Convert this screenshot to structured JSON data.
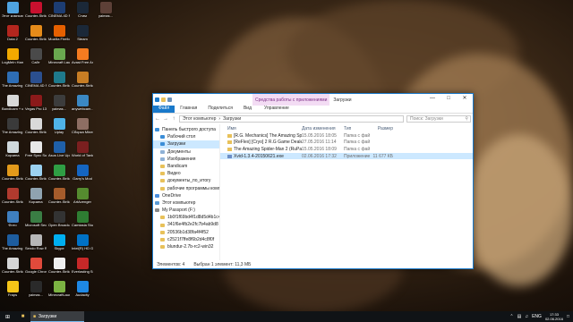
{
  "desktop": {
    "icons": [
      {
        "label": "Этот компьютер",
        "color": "#4fa3e0"
      },
      {
        "label": "Dota 2",
        "color": "#b3261e"
      },
      {
        "label": "LogMeIn Hamachi",
        "color": "#f2a900"
      },
      {
        "label": "The Amazing Spider-Man 2",
        "color": "#2e6db4"
      },
      {
        "label": "Bandicam + ключ",
        "color": "#d8d8d8"
      },
      {
        "label": "The Amazing Spider-Man 2",
        "color": "#3a3a3a"
      },
      {
        "label": "Корзина",
        "color": "#cfd8dc"
      },
      {
        "label": "Counter-Strike Global...",
        "color": "#e39a1b"
      },
      {
        "label": "Counter-Strike Source",
        "color": "#b03a2e"
      },
      {
        "label": "Фото",
        "color": "#3f7fbf"
      },
      {
        "label": "The Amazing Spider-Man 2",
        "color": "#1e5d9e"
      },
      {
        "label": "Counter-Strike 1.6",
        "color": "#d6d6d6"
      },
      {
        "label": "Fraps",
        "color": "#f5c518"
      },
      {
        "label": "Counter-Strike Global...",
        "color": "#c8102e"
      },
      {
        "label": "Counter-Strike 1.6",
        "color": "#e58b1a"
      },
      {
        "label": "Сайт",
        "color": "#4a4a4a"
      },
      {
        "label": "CINEMA 4D R14 64 Bit",
        "color": "#2b4f8e"
      },
      {
        "label": "Vegas Pro 13.0 (64...",
        "color": "#8b1a1a"
      },
      {
        "label": "Counter-Strike 1.6 (T...",
        "color": "#d9d9d9"
      },
      {
        "label": "Free Sync Sound Pack",
        "color": "#e8e8e8"
      },
      {
        "label": "Counter-Strike 1.6",
        "color": "#9bd1f0"
      },
      {
        "label": "Корзина",
        "color": "#8fa3b0"
      },
      {
        "label": "Microsoft Security Ess...",
        "color": "#3a7d44"
      },
      {
        "label": "Sendo Row Ra",
        "color": "#b7b7b7"
      },
      {
        "label": "Google Chrome",
        "color": "#e04a3b"
      },
      {
        "label": "yaimas...",
        "color": "#2a2a2a"
      },
      {
        "label": "CINEMA 4D R14",
        "color": "#1d3d73"
      },
      {
        "label": "Mozilla Firefox",
        "color": "#e66000"
      },
      {
        "label": "Minecraft Launcher",
        "color": "#6aa84f"
      },
      {
        "label": "Counter-Strike 1.6...",
        "color": "#1f7a8c"
      },
      {
        "label": "yaimas...",
        "color": "#3c3c3c"
      },
      {
        "label": "Uplay",
        "color": "#4fb3e8"
      },
      {
        "label": "Asus Live Update 3",
        "color": "#1f5fa8"
      },
      {
        "label": "Counter-Strike 1.6 Ed...",
        "color": "#2f9e44"
      },
      {
        "label": "Counter-Strike 1.6 (T...",
        "color": "#a65c2b"
      },
      {
        "label": "Open Broadcast...",
        "color": "#333333"
      },
      {
        "label": "Skype",
        "color": "#00aff0"
      },
      {
        "label": "Counter-Strike...",
        "color": "#efefef"
      },
      {
        "label": "MinecraftLauncher",
        "color": "#7cb342"
      },
      {
        "label": "Стим",
        "color": "#1b2838"
      },
      {
        "label": "Steam",
        "color": "#1b2838"
      },
      {
        "label": "Avast Free Antivirus",
        "color": "#f47b20"
      },
      {
        "label": "Counter-Strike Global...",
        "color": "#c77d24"
      },
      {
        "label": "anywebcam...",
        "color": "#3b88c3"
      },
      {
        "label": "Сборка Minecraft",
        "color": "#8d6e63"
      },
      {
        "label": "World of Tanks",
        "color": "#7a1f1f"
      },
      {
        "label": "Garry's Mod",
        "color": "#1565c0"
      },
      {
        "label": "ArtAvenger",
        "color": "#558b2f"
      },
      {
        "label": "Camtasia Studio 8",
        "color": "#2e7d32"
      },
      {
        "label": "Intel(R) HD Graphics C...",
        "color": "#0071c5"
      },
      {
        "label": "Everlasting Summer",
        "color": "#c62828"
      },
      {
        "label": "Audacity",
        "color": "#1e88e5"
      },
      {
        "label": "yaimas...",
        "color": "#5d4037"
      }
    ]
  },
  "explorer": {
    "title": "Загрузки",
    "context_tab": "Средства работы с приложениями",
    "ribbon_tabs": [
      "Файл",
      "Главная",
      "Поделиться",
      "Вид",
      "Управление"
    ],
    "address": [
      "Этот компьютер",
      "Загрузки"
    ],
    "search_placeholder": "Поиск: Загрузки",
    "nav": [
      {
        "label": "Панель быстрого доступа",
        "color": "#3b8ed8"
      },
      {
        "label": "Рабочий стол",
        "color": "#3b8ed8"
      },
      {
        "label": "Загрузки",
        "color": "#3b8ed8",
        "selected": true
      },
      {
        "label": "Документы",
        "color": "#8fb1d6"
      },
      {
        "label": "Изображения",
        "color": "#8fb1d6"
      },
      {
        "label": "Bandicam",
        "color": "#e8c15a"
      },
      {
        "label": "Видео",
        "color": "#e8c15a"
      },
      {
        "label": "документы_по_итогу",
        "color": "#e8c15a"
      },
      {
        "label": "рабочие программы компании",
        "color": "#e8c15a"
      },
      {
        "label": "OneDrive",
        "color": "#4a8ede"
      },
      {
        "label": "Этот компьютер",
        "color": "#5b9bd5"
      },
      {
        "label": "My Passport (F:)",
        "color": "#888888"
      },
      {
        "label": "1b0f1f69bd4f1d8d5d4b1c4",
        "color": "#e8c15a"
      },
      {
        "label": "341f6e4fb2e2fc7b4ab9d8",
        "color": "#e8c15a"
      },
      {
        "label": "20536b1d38fa4f4f52",
        "color": "#e8c15a"
      },
      {
        "label": "c2521f7ffe8f6b2d4c8f0f",
        "color": "#e8c15a"
      },
      {
        "label": "blundur-2.7b-rc2-win32",
        "color": "#e8c15a"
      }
    ],
    "columns": [
      "Имя",
      "Дата изменения",
      "Тип",
      "Размер"
    ],
    "files": [
      {
        "name": "[R.G. Mechanics] The Amazing Spider-Man 2",
        "date": "15.05.2016 18:05",
        "type": "Папка с файлами",
        "size": "",
        "color": "#e8c15a"
      },
      {
        "name": "[ReFlex] [Cryo] 2 R.G Game Dealer",
        "date": "27.05.2016 11:14",
        "type": "Папка с файлами",
        "size": "",
        "color": "#e8c15a"
      },
      {
        "name": "The Amazing Spider-Man 2 (RuPack.in S...",
        "date": "15.05.2016 18:09",
        "type": "Папка с файлами",
        "size": "",
        "color": "#e8c15a"
      },
      {
        "name": "Xvid-1.3.4-20150621.exe",
        "date": "02.06.2016 17:32",
        "type": "Приложение",
        "size": "11 677 КБ",
        "color": "#6c8fc7",
        "selected": true
      }
    ],
    "status": {
      "count": "Элементов: 4",
      "selected": "Выбран 1 элемент: 11,3 МБ"
    }
  },
  "taskbar": {
    "app_label": "Загрузки",
    "lang": "ENG",
    "time": "17:33",
    "date": "02.06.2016"
  }
}
